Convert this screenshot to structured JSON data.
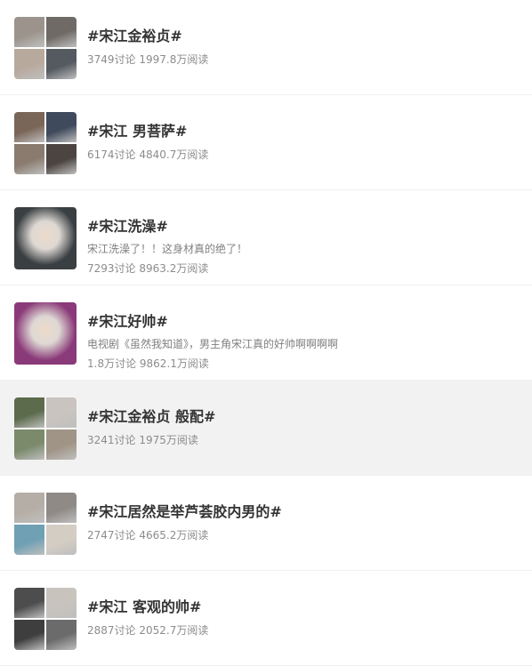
{
  "topics": [
    {
      "title": "#宋江金裕贞#",
      "desc": "",
      "stats": "3749讨论 1997.8万阅读",
      "highlight": false,
      "thumb_colors": [
        "#9c948c",
        "#6f6a66",
        "#b8a99d",
        "#545a60"
      ]
    },
    {
      "title": "#宋江 男菩萨#",
      "desc": "",
      "stats": "6174讨论 4840.7万阅读",
      "highlight": false,
      "thumb_colors": [
        "#7a6658",
        "#3f4a5c",
        "#8a7b6e",
        "#4b4440"
      ]
    },
    {
      "title": "#宋江洗澡#",
      "desc": "宋江洗澡了！！这身材真的绝了！",
      "stats": "7293讨论 8963.2万阅读",
      "highlight": false,
      "thumb_colors": [
        "#3a3f42"
      ]
    },
    {
      "title": "#宋江好帅#",
      "desc": "电视剧《虽然我知道》，男主角宋江真的好帅啊啊啊啊",
      "stats": "1.8万讨论 9862.1万阅读",
      "highlight": false,
      "thumb_colors": [
        "#8a3a78"
      ]
    },
    {
      "title": "#宋江金裕贞 般配#",
      "desc": "",
      "stats": "3241讨论 1975万阅读",
      "highlight": true,
      "thumb_colors": [
        "#5c6b4c",
        "#c9c4bf",
        "#7a8a6a",
        "#a09486"
      ]
    },
    {
      "title": "#宋江居然是举芦荟胶内男的#",
      "desc": "",
      "stats": "2747讨论 4665.2万阅读",
      "highlight": false,
      "thumb_colors": [
        "#b5aea6",
        "#8f8a86",
        "#6fa0b4",
        "#d4cdc4"
      ]
    },
    {
      "title": "#宋江 客观的帅#",
      "desc": "",
      "stats": "2887讨论 2052.7万阅读",
      "highlight": false,
      "thumb_colors": [
        "#4d4d4d",
        "#c8c3bd",
        "#3e3e3e",
        "#6b6b6b"
      ]
    }
  ]
}
